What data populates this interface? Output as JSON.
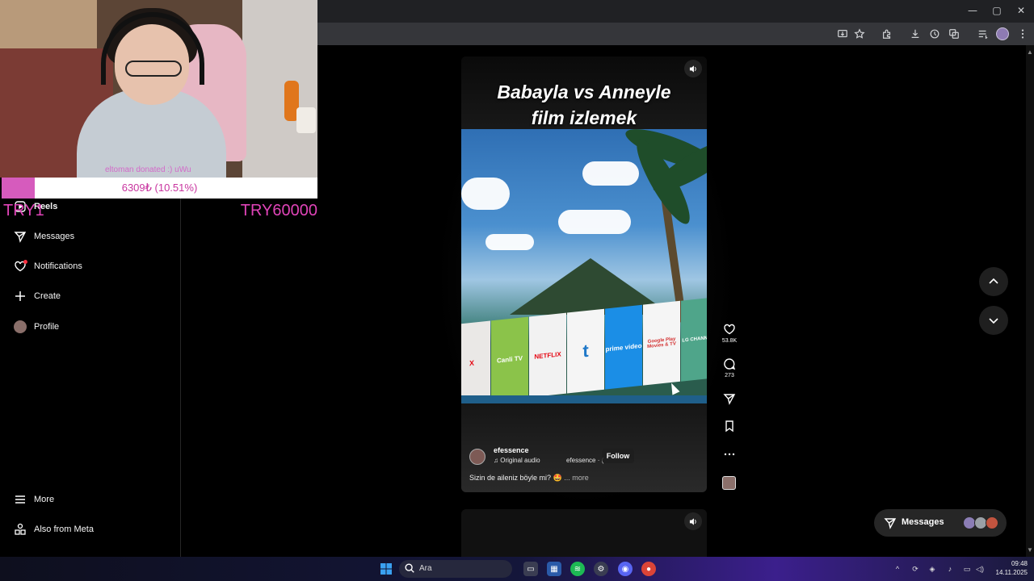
{
  "browser": {
    "window_controls": {
      "minimize": "—",
      "maximize": "▢",
      "close": "✕"
    }
  },
  "overlay": {
    "webcam_text": "eltoman donated :) uWu",
    "donation": {
      "label": "6309₺ (10.51%)",
      "progress_fraction": 0.1051
    },
    "goal_left": "TRY1",
    "goal_right": "TRY60000"
  },
  "sidebar": {
    "items": [
      {
        "label": "Reels",
        "icon": "reels-icon"
      },
      {
        "label": "Messages",
        "icon": "send-icon"
      },
      {
        "label": "Notifications",
        "icon": "heart-icon"
      },
      {
        "label": "Create",
        "icon": "plus-icon"
      },
      {
        "label": "Profile",
        "icon": "avatar"
      }
    ],
    "bottom": [
      {
        "label": "More",
        "icon": "menu-icon"
      },
      {
        "label": "Also from Meta",
        "icon": "meta-apps-icon"
      }
    ]
  },
  "reel": {
    "title_line1": "Babayla vs Anneyle",
    "title_line2": "film izlemek",
    "apps": [
      "X",
      "Canli TV",
      "NETFLIX",
      "t",
      "prime video",
      "Google Play Movies & TV",
      "LG CHANNELS"
    ],
    "app_sub_netflix": "Netflix",
    "username": "efessence",
    "audio": "♫ Original audio",
    "audio_user": "efessence · (",
    "follow": "Follow",
    "caption": "Sizin de aileniz böyle mi? 🤩",
    "caption_more": "... more"
  },
  "actions": {
    "likes": "53.8K",
    "comments": "273"
  },
  "messages_pill": {
    "label": "Messages"
  },
  "taskbar": {
    "search_label": "Ara",
    "time": "09:48",
    "date": "14.11.2025"
  },
  "colors": {
    "donation_fill": "#d65bbd",
    "goal_text": "#e044b8",
    "notification_dot": "#ff3040"
  }
}
